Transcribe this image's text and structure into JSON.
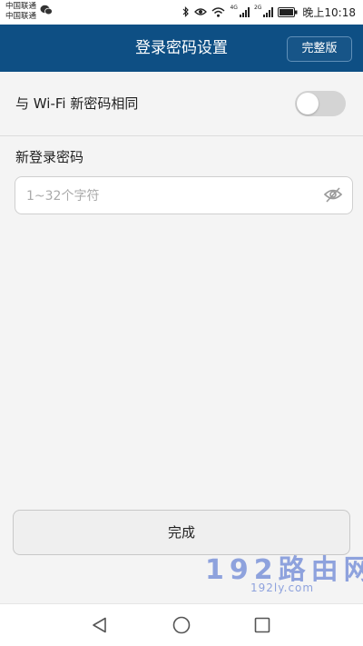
{
  "status_bar": {
    "carrier_1": "中国联通",
    "carrier_2": "中国联通",
    "signal_label_1": "4G",
    "signal_label_2": "2G",
    "time": "晚上10:18",
    "icons": [
      "wechat-icon",
      "bluetooth-icon",
      "eye-icon",
      "wifi-icon",
      "signal-icon",
      "signal-icon",
      "battery-icon"
    ]
  },
  "header": {
    "title": "登录密码设置",
    "full_version_label": "完整版"
  },
  "sync_option": {
    "label": "与 Wi-Fi 新密码相同",
    "enabled": false
  },
  "new_password": {
    "label": "新登录密码",
    "value": "",
    "placeholder": "1~32个字符",
    "visibility_icon": "eye-off-icon"
  },
  "done_button": {
    "label": "完成"
  },
  "watermark": {
    "main": "192路由网",
    "sub": "192ly.com"
  },
  "nav_bar": {
    "icons": [
      "back-icon",
      "home-icon",
      "recent-apps-icon"
    ]
  },
  "colors": {
    "header_bg": "#0e4f84",
    "page_bg": "#f4f4f4",
    "toggle_off": "#d4d4d4",
    "watermark": "#6d87d6"
  }
}
